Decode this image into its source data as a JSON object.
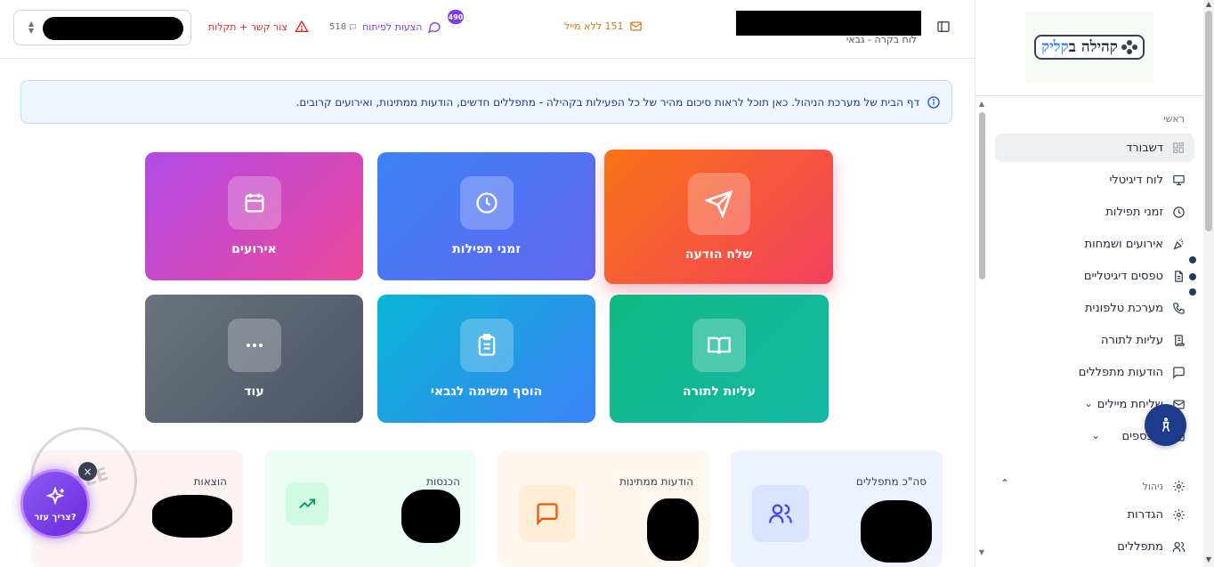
{
  "sidebar": {
    "logo": {
      "text_part1": "קהילה ב",
      "text_part2": "קליק"
    },
    "section_main": "ראשי",
    "items": [
      {
        "label": "דשבורד",
        "icon": "dashboard-icon"
      },
      {
        "label": "לוח דיגיטלי",
        "icon": "monitor-icon"
      },
      {
        "label": "זמני תפילות",
        "icon": "clock-icon"
      },
      {
        "label": "אירועים ושמחות",
        "icon": "party-popper-icon"
      },
      {
        "label": "טפסים דיגיטליים",
        "icon": "file-text-icon"
      },
      {
        "label": "מערכת טלפונית",
        "icon": "phone-icon"
      },
      {
        "label": "עליות לתורה",
        "icon": "scroll-icon"
      },
      {
        "label": "הודעות מתפללים",
        "icon": "message-square-icon"
      },
      {
        "label": "שליחת מיילים",
        "icon": "mail-icon"
      },
      {
        "label": "ל כספים",
        "icon": "wallet-icon"
      }
    ],
    "section_manage": "ניהול",
    "manage_items": [
      {
        "label": "הגדרות",
        "icon": "gear-icon"
      },
      {
        "label": "מתפללים",
        "icon": "users-icon"
      }
    ]
  },
  "header": {
    "subtitle": "לוח בקרה - גבאי",
    "mail_status": "151 ללא מייל",
    "suggestions_label": "הצעות לפיתוח",
    "suggestions_count": "518",
    "suggestions_badge": "490",
    "support_label": "צור קשר + תקלות"
  },
  "info_banner": "דף הבית של מערכת הניהול. כאן תוכל לראות סיכום מהיר של כל הפעילות בקהילה - מתפללים חדשים, הודעות ממתינות, ואירועים קרובים.",
  "tiles": {
    "send_message": "שלח הודעה",
    "prayer_times": "זמני תפילות",
    "events": "אירועים",
    "torah": "עליות לתורה",
    "add_task": "הוסף משימה לגבאי",
    "more": "עוד"
  },
  "stats": {
    "members": "סה\"כ מתפללים",
    "pending": "הודעות ממתינות",
    "income": "הכנסות",
    "expenses": "הוצאות"
  },
  "help": {
    "label": "צריך עזר?",
    "stamp": "FREE"
  },
  "colors": {
    "accent_purple": "#7c3aed",
    "send_tile": "#f97316",
    "info_blue": "#eff6ff"
  }
}
